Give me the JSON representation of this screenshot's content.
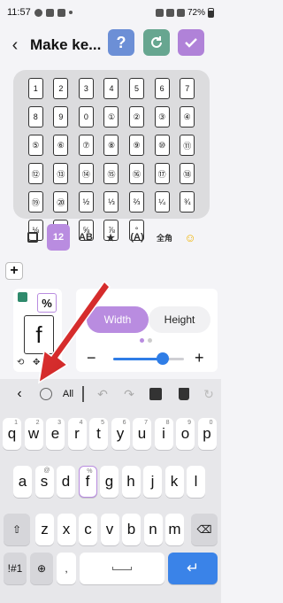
{
  "status": {
    "time": "11:57",
    "battery": "72%"
  },
  "header": {
    "title": "Make ke..."
  },
  "grid": {
    "keys": [
      "1",
      "2",
      "3",
      "4",
      "5",
      "6",
      "7",
      "8",
      "9",
      "0",
      "①",
      "②",
      "③",
      "④",
      "⑤",
      "⑥",
      "⑦",
      "⑧",
      "⑨",
      "⑩",
      "⑪",
      "⑫",
      "⑬",
      "⑭",
      "⑮",
      "⑯",
      "⑰",
      "⑱",
      "⑲",
      "⑳",
      "½",
      "⅓",
      "⅔",
      "¼",
      "¾",
      "⅛",
      "⅜",
      "⅝",
      "⅞",
      "°"
    ]
  },
  "categories": {
    "numbers": "12",
    "letters": "AB",
    "parens": "(A)",
    "fullwidth": "全角"
  },
  "editor": {
    "secondary_char": "%",
    "main_char": "f"
  },
  "size_panel": {
    "tab_width": "Width",
    "tab_height": "Height",
    "slider_level": 0.7
  },
  "toolbar": {
    "all_label": "All"
  },
  "keyboard": {
    "row1": [
      {
        "c": "q",
        "s": "1"
      },
      {
        "c": "w",
        "s": "2"
      },
      {
        "c": "e",
        "s": "3"
      },
      {
        "c": "r",
        "s": "4"
      },
      {
        "c": "t",
        "s": "5"
      },
      {
        "c": "y",
        "s": "6"
      },
      {
        "c": "u",
        "s": "7"
      },
      {
        "c": "i",
        "s": "8"
      },
      {
        "c": "o",
        "s": "9"
      },
      {
        "c": "p",
        "s": "0"
      }
    ],
    "row2": [
      {
        "c": "a",
        "s": ""
      },
      {
        "c": "s",
        "s": "@"
      },
      {
        "c": "d",
        "s": ""
      },
      {
        "c": "f",
        "s": "%"
      },
      {
        "c": "g",
        "s": ""
      },
      {
        "c": "h",
        "s": ""
      },
      {
        "c": "j",
        "s": ""
      },
      {
        "c": "k",
        "s": ""
      },
      {
        "c": "l",
        "s": ""
      }
    ],
    "row3": [
      "z",
      "x",
      "c",
      "v",
      "b",
      "n",
      "m"
    ],
    "symbols_label": "!#1",
    "space_label": ""
  }
}
